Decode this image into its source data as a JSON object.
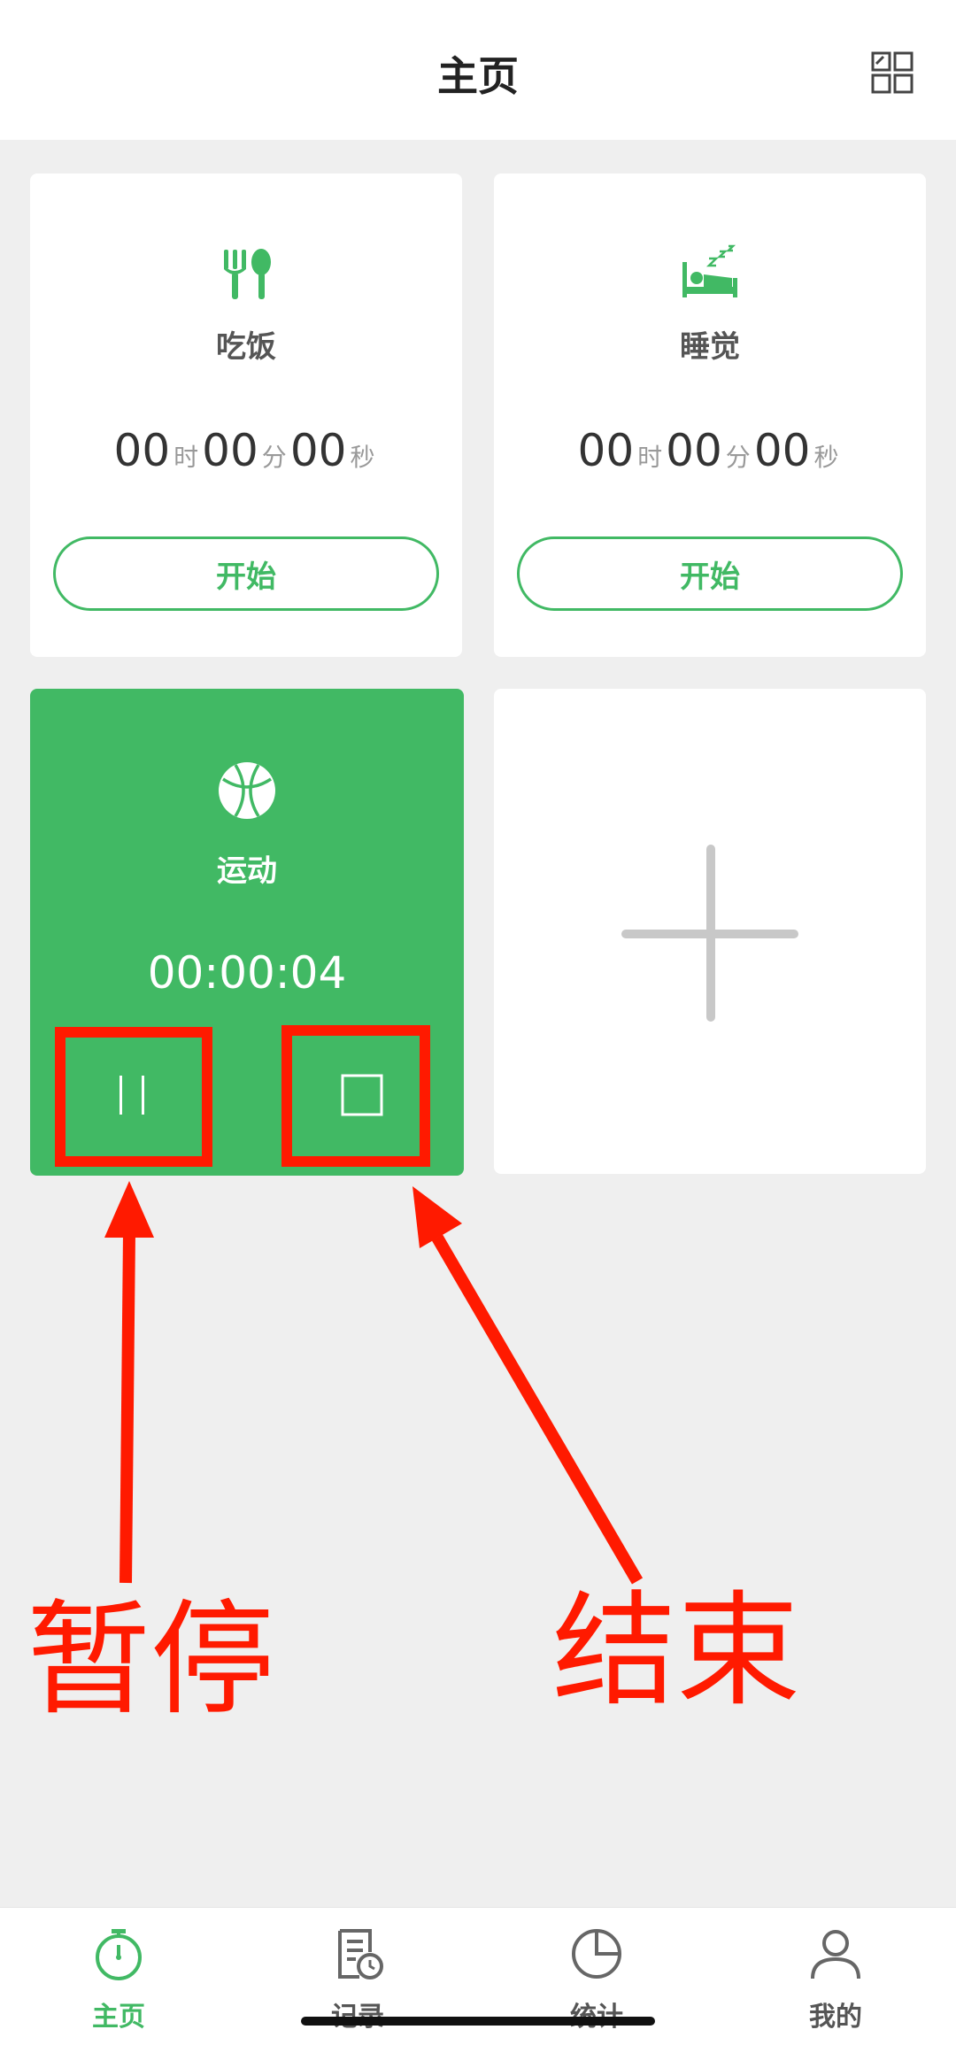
{
  "header": {
    "title": "主页"
  },
  "units": {
    "hour": "时",
    "minute": "分",
    "second": "秒"
  },
  "cards": [
    {
      "title": "吃饭",
      "hours": "00",
      "minutes": "00",
      "seconds": "00",
      "start_label": "开始",
      "icon": "fork-spoon-icon"
    },
    {
      "title": "睡觉",
      "hours": "00",
      "minutes": "00",
      "seconds": "00",
      "start_label": "开始",
      "icon": "sleeping-bed-icon"
    }
  ],
  "active_card": {
    "title": "运动",
    "elapsed": "00:00:04",
    "icon": "basketball-icon"
  },
  "annotations": {
    "pause": "暂停",
    "stop": "结束"
  },
  "nav": [
    {
      "label": "主页",
      "icon": "stopwatch-icon",
      "active": true
    },
    {
      "label": "记录",
      "icon": "record-doc-icon",
      "active": false
    },
    {
      "label": "统计",
      "icon": "pie-chart-icon",
      "active": false
    },
    {
      "label": "我的",
      "icon": "user-icon",
      "active": false
    }
  ],
  "colors": {
    "accent": "#41b964",
    "annotation": "#ff1a00",
    "background": "#efefef"
  }
}
